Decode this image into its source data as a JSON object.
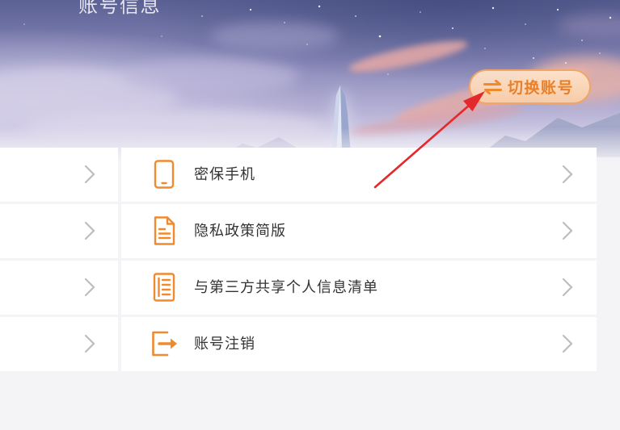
{
  "page": {
    "title": "账号信息"
  },
  "switch_account": {
    "label": "切换账号",
    "icon": "swap-arrows-icon"
  },
  "menu": {
    "left_items": [
      {
        "icon": "chevron-right-icon"
      },
      {
        "icon": "chevron-right-icon"
      },
      {
        "icon": "chevron-right-icon"
      },
      {
        "icon": "chevron-right-icon"
      }
    ],
    "items": [
      {
        "label": "密保手机",
        "icon": "phone-icon",
        "chevron": "chevron-right-icon"
      },
      {
        "label": "隐私政策简版",
        "icon": "document-icon",
        "chevron": "chevron-right-icon"
      },
      {
        "label": "与第三方共享个人信息清单",
        "icon": "list-document-icon",
        "chevron": "chevron-right-icon"
      },
      {
        "label": "账号注销",
        "icon": "logout-icon",
        "chevron": "chevron-right-icon"
      }
    ]
  },
  "colors": {
    "accent": "#ef8a2f",
    "annotation": "#e3292b",
    "label_text": "#333333",
    "chevron": "#bdbdbd"
  }
}
